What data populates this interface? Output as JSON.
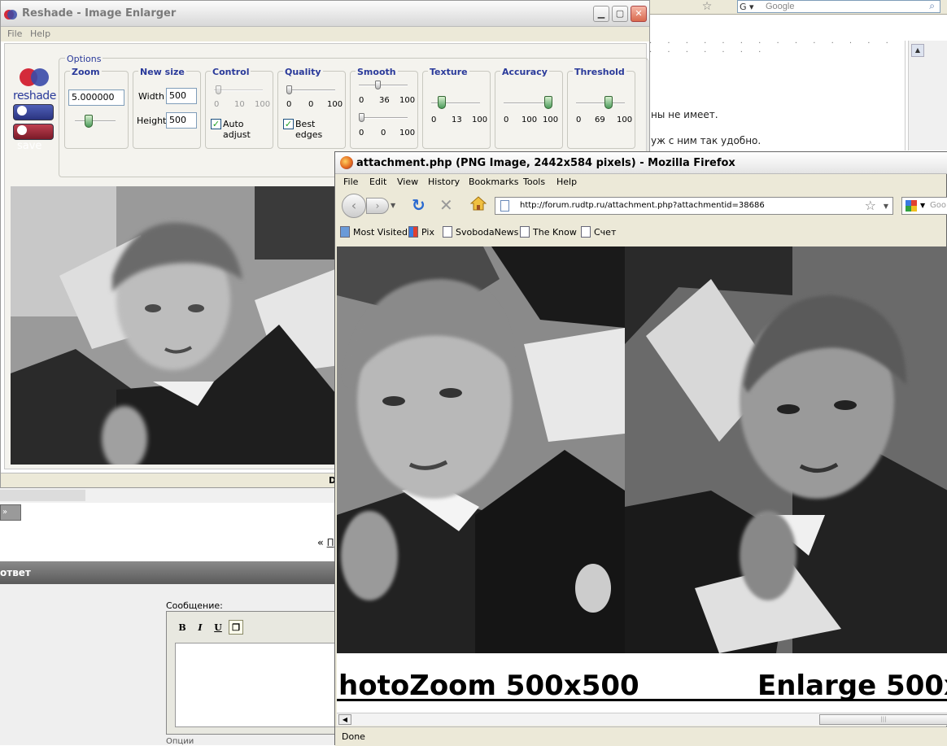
{
  "background": {
    "search_placeholder": "Google",
    "page_lines": [
      "ны не имеет.",
      "уж с ним так удобно."
    ],
    "nav_link_arrow": "«",
    "nav_link": "П",
    "button_label": "»",
    "reply_bar": "ответ",
    "message_label": "Сообщение:",
    "toolbar": [
      "B",
      "I",
      "U"
    ],
    "options_label": "Опции"
  },
  "reshade": {
    "title": "Reshade - Image Enlarger",
    "menu": [
      "File",
      "Help"
    ],
    "logo_text": "reshade",
    "open_label": "open",
    "save_label": "save",
    "options_label": "Options",
    "zoom": {
      "title": "Zoom",
      "value": "5.000000"
    },
    "new_size": {
      "title": "New size",
      "width_label": "Width",
      "width_value": "500",
      "height_label": "Height",
      "height_value": "500"
    },
    "control": {
      "title": "Control",
      "min": "0",
      "mid": "10",
      "max": "100",
      "auto_adjust": "Auto adjust",
      "auto_adjust_checked": true
    },
    "quality": {
      "title": "Quality",
      "min": "0",
      "mid": "0",
      "max": "100",
      "best_edges": "Best edges",
      "best_edges_checked": true
    },
    "smooth": {
      "title": "Smooth",
      "s1_min": "0",
      "s1_mid": "36",
      "s1_max": "100",
      "s2_min": "0",
      "s2_mid": "0",
      "s2_max": "100"
    },
    "texture": {
      "title": "Texture",
      "min": "0",
      "mid": "13",
      "max": "100"
    },
    "accuracy": {
      "title": "Accuracy",
      "min": "0",
      "mid": "100",
      "max": "100"
    },
    "threshold": {
      "title": "Threshold",
      "min": "0",
      "mid": "69",
      "max": "100"
    },
    "status": "D"
  },
  "firefox": {
    "title": "attachment.php (PNG Image, 2442x584 pixels) - Mozilla Firefox",
    "menu": [
      "File",
      "Edit",
      "View",
      "History",
      "Bookmarks",
      "Tools",
      "Help"
    ],
    "url": "http://forum.rudtp.ru/attachment.php?attachmentid=38686",
    "search_placeholder": "Goo",
    "bookmarks": [
      "Most Visited",
      "Pix",
      "SvobodaNews",
      "The Know",
      "Счет"
    ],
    "caption_left": "hotoZoom 500x500",
    "caption_right": "Enlarge 500x",
    "status": "Done"
  },
  "colors": {
    "accent": "#2a3a9a",
    "reshade_red": "#d42a3a",
    "reshade_blue": "#3a4aa8"
  }
}
